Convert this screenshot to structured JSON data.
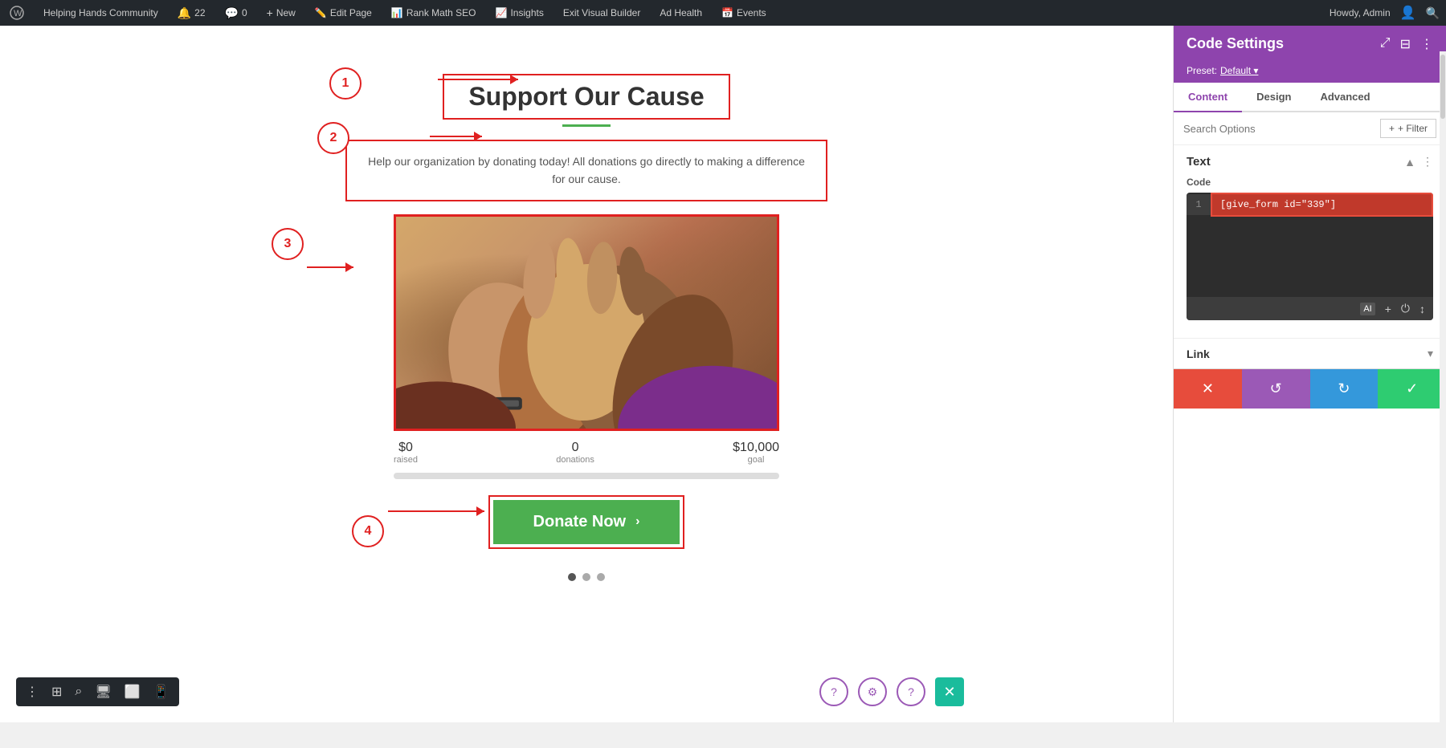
{
  "adminBar": {
    "siteName": "Helping Hands Community",
    "updateCount": "22",
    "commentCount": "0",
    "newLabel": "+ New",
    "editPage": "Edit Page",
    "rankMath": "Rank Math SEO",
    "insights": "Insights",
    "exitBuilder": "Exit Visual Builder",
    "adHealth": "Ad Health",
    "events": "Events",
    "howdy": "Howdy, Admin"
  },
  "canvas": {
    "titleText": "Support Our Cause",
    "descriptionText": "Help our organization by donating today! All donations go directly to making a difference for our cause.",
    "stats": {
      "raised": "$0",
      "raisedLabel": "raised",
      "donations": "0",
      "donationsLabel": "donations",
      "goal": "$10,000",
      "goalLabel": "goal"
    },
    "donateButton": "Donate Now",
    "annotations": {
      "1": "1",
      "2": "2",
      "3": "3",
      "4": "4"
    }
  },
  "rightPanel": {
    "title": "Code Settings",
    "preset": "Preset: Default",
    "tabs": {
      "content": "Content",
      "design": "Design",
      "advanced": "Advanced"
    },
    "searchPlaceholder": "Search Options",
    "filterLabel": "+ Filter",
    "sectionTitle": "Text",
    "codeLabel": "Code",
    "codeValue": "[give_form id=\"339\"]",
    "lineNumber": "1",
    "linkLabel": "Link"
  },
  "bottomToolbar": {
    "icons": [
      "⋮",
      "⊞",
      "🔍",
      "🖥",
      "📱",
      "📱"
    ]
  }
}
